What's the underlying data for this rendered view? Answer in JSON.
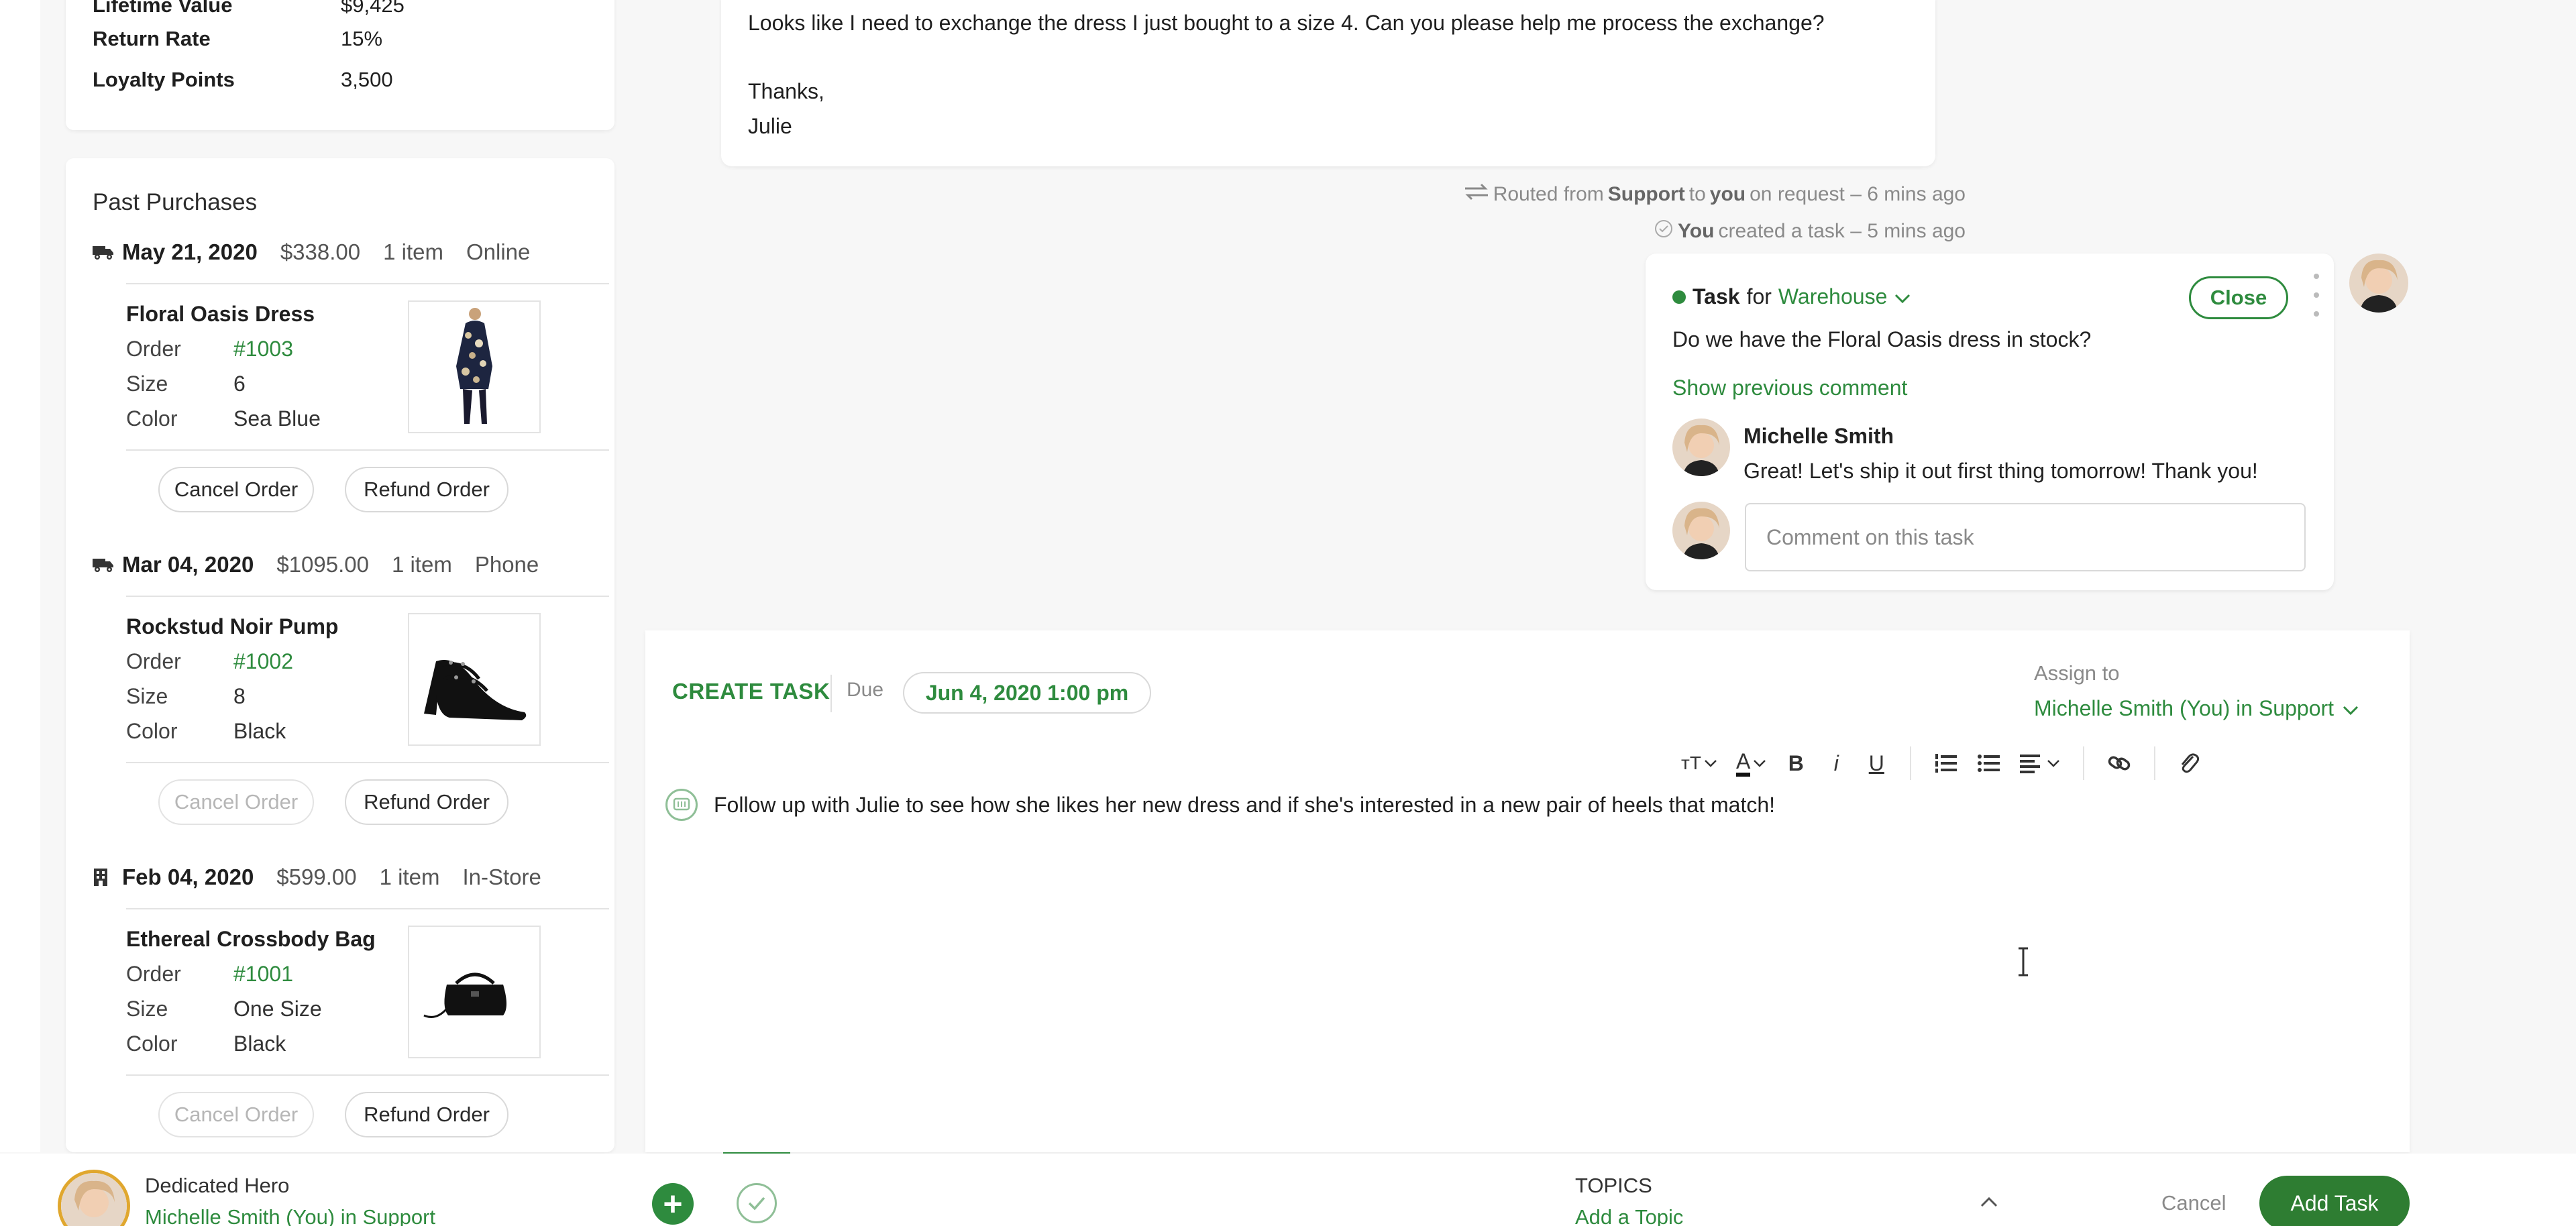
{
  "customer_stats": {
    "lifetime_value_label": "Lifetime Value",
    "lifetime_value": "$9,425",
    "return_rate_label": "Return Rate",
    "return_rate": "15%",
    "loyalty_points_label": "Loyalty Points",
    "loyalty_points": "3,500"
  },
  "past_purchases": {
    "title": "Past Purchases",
    "labels": {
      "order": "Order",
      "size": "Size",
      "color": "Color"
    },
    "buttons": {
      "cancel": "Cancel Order",
      "refund": "Refund Order"
    },
    "purchases": [
      {
        "date": "May 21, 2020",
        "amount": "$338.00",
        "items": "1 item",
        "channel": "Online",
        "channel_icon": "truck-icon",
        "product": "Floral Oasis Dress",
        "order": "#1003",
        "size": "6",
        "color": "Sea Blue",
        "cancel_enabled": true
      },
      {
        "date": "Mar 04, 2020",
        "amount": "$1095.00",
        "items": "1 item",
        "channel": "Phone",
        "channel_icon": "truck-icon",
        "product": "Rockstud Noir Pump",
        "order": "#1002",
        "size": "8",
        "color": "Black",
        "cancel_enabled": false
      },
      {
        "date": "Feb 04, 2020",
        "amount": "$599.00",
        "items": "1 item",
        "channel": "In-Store",
        "channel_icon": "store-icon",
        "product": "Ethereal Crossbody Bag",
        "order": "#1001",
        "size": "One Size",
        "color": "Black",
        "cancel_enabled": false
      }
    ]
  },
  "message": {
    "line1": "Looks like I need to exchange the dress I just bought to a size 4. Can you please help me process the exchange?",
    "line2": "Thanks,",
    "line3": "Julie"
  },
  "activity": {
    "routed_prefix": "Routed from",
    "routed_from": "Support",
    "routed_to_word": "to",
    "routed_to": "you",
    "routed_suffix": "on request – 6 mins ago",
    "created_actor": "You",
    "created_suffix": "created a task – 5 mins ago"
  },
  "task": {
    "label": "Task",
    "for_word": "for",
    "team": "Warehouse",
    "close_label": "Close",
    "question": "Do we have the Floral Oasis dress in stock?",
    "show_previous": "Show previous comment",
    "commenter": "Michelle Smith",
    "comment": "Great! Let's ship it out first thing tomorrow! Thank you!",
    "comment_placeholder": "Comment on this task"
  },
  "create_task": {
    "title": "CREATE TASK",
    "due_label": "Due",
    "due_value": "Jun 4, 2020 1:00 pm",
    "assign_label": "Assign to",
    "assign_value": "Michelle Smith (You) in Support",
    "toolbar": {
      "text_size": "тT",
      "font_color": "A",
      "bold": "B",
      "italic": "i",
      "underline": "U"
    },
    "body_text": "Follow up with Julie to see how she likes her new dress and if she's interested in a new pair of heels that match!"
  },
  "bottom_bar": {
    "agent_name": "Dedicated Hero",
    "agent_assignment": "Michelle Smith (You) in Support",
    "topics_label": "TOPICS",
    "add_topic": "Add a Topic",
    "cancel": "Cancel",
    "add_task": "Add Task"
  },
  "colors": {
    "accent": "#2e8b3e",
    "button": "#2e7d32",
    "muted": "#8a8a8a",
    "border": "#d9d9d9"
  }
}
